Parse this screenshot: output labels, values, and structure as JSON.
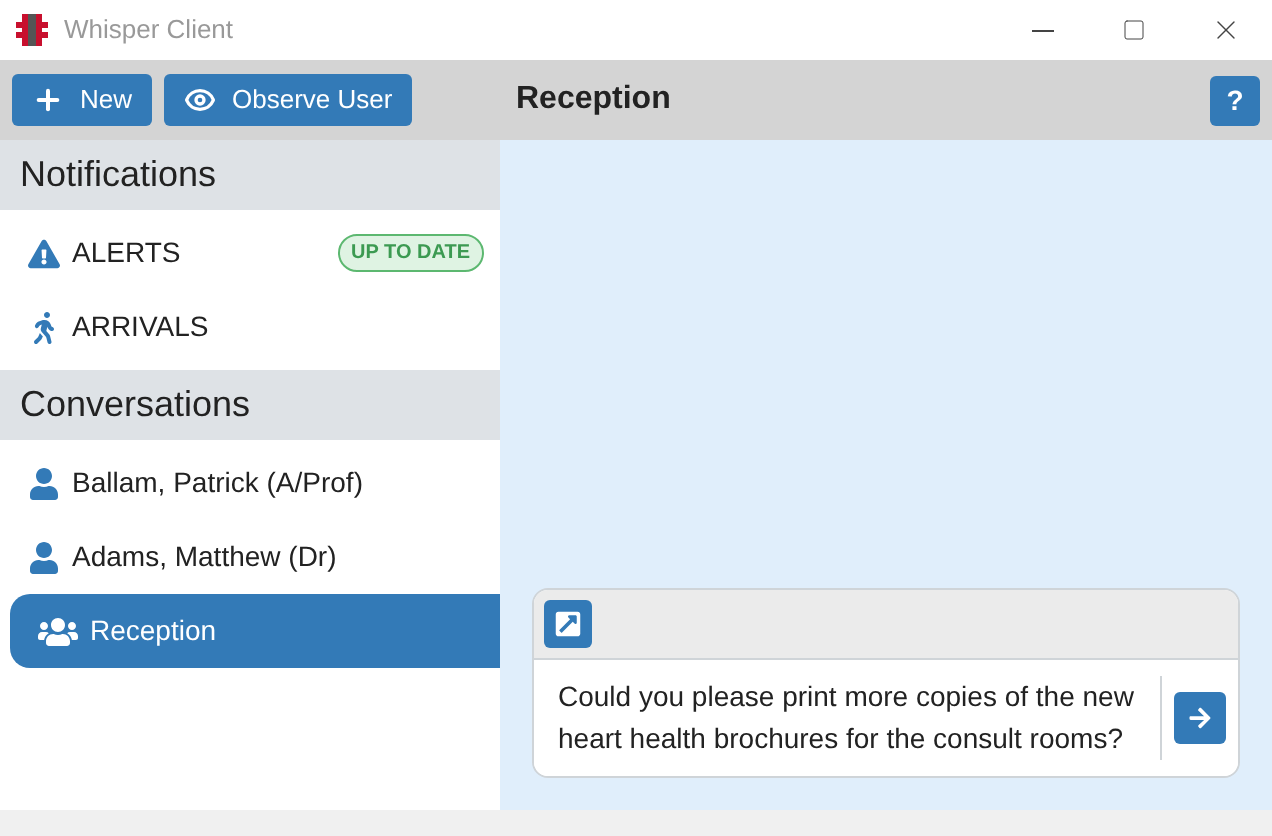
{
  "window": {
    "title": "Whisper Client"
  },
  "toolbar": {
    "buttons": [
      {
        "kind": "new",
        "label": "New"
      },
      {
        "kind": "observe",
        "label": "Observe User"
      }
    ],
    "title": "Reception",
    "help": "?"
  },
  "sidebar": {
    "sections": [
      {
        "title": "Notifications",
        "items": [
          {
            "kind": "alert",
            "label": "ALERTS",
            "badge": "UP TO DATE",
            "selected": false
          },
          {
            "kind": "arrival",
            "label": "ARRIVALS",
            "selected": false
          }
        ]
      },
      {
        "title": "Conversations",
        "items": [
          {
            "kind": "person",
            "label": "Ballam, Patrick (A/Prof)",
            "selected": false
          },
          {
            "kind": "person",
            "label": "Adams, Matthew (Dr)",
            "selected": false
          },
          {
            "kind": "group",
            "label": "Reception",
            "selected": true
          }
        ]
      }
    ]
  },
  "composer": {
    "value": "Could you please print more copies of the new heart health brochures for the consult rooms?"
  }
}
